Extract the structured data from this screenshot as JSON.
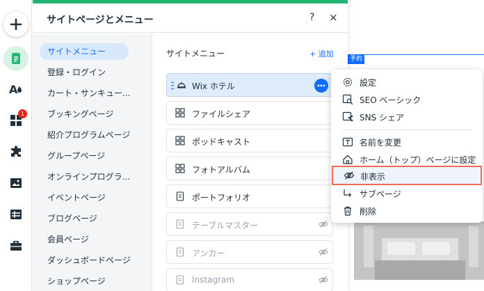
{
  "rail": {
    "items": [
      {
        "name": "add"
      },
      {
        "name": "pages"
      },
      {
        "name": "theme"
      },
      {
        "name": "apps",
        "badge": "1"
      },
      {
        "name": "plugins"
      },
      {
        "name": "media"
      },
      {
        "name": "table"
      },
      {
        "name": "business"
      }
    ]
  },
  "panel": {
    "title": "サイトページとメニュー",
    "help": "?",
    "close": "×",
    "categories": [
      "サイトメニュー",
      "登録・ログイン",
      "カート・サンキュー...",
      "ブッキングページ",
      "紹介プログラムページ",
      "グループページ",
      "オンラインプログラ...",
      "イベントページ",
      "ブログページ",
      "会員ページ",
      "ダッシュボードページ",
      "ショップページ"
    ],
    "active_category": "サイトメニュー",
    "menu_title": "サイトメニュー",
    "add_label": "+ 追加",
    "menu_items": [
      {
        "label": "Wix ホテル",
        "icon": "hotel-icon",
        "selected": true,
        "hidden": false
      },
      {
        "label": "ファイルシェア",
        "icon": "app-icon",
        "selected": false,
        "hidden": false
      },
      {
        "label": "ポッドキャスト",
        "icon": "app-icon",
        "selected": false,
        "hidden": false
      },
      {
        "label": "フォトアルバム",
        "icon": "app-icon",
        "selected": false,
        "hidden": false
      },
      {
        "label": "ポートフォリオ",
        "icon": "page-icon",
        "selected": false,
        "hidden": false
      },
      {
        "label": "テーブルマスター",
        "icon": "page-icon",
        "selected": false,
        "hidden": true
      },
      {
        "label": "アンカー",
        "icon": "page-icon",
        "selected": false,
        "hidden": true
      },
      {
        "label": "Instagram",
        "icon": "page-icon",
        "selected": false,
        "hidden": true
      }
    ]
  },
  "context_menu": {
    "items": [
      {
        "label": "設定",
        "icon": "gear-icon"
      },
      {
        "label": "SEO ベーシック",
        "icon": "seo-icon"
      },
      {
        "label": "SNS シェア",
        "icon": "share-icon"
      },
      {
        "label": "名前を変更",
        "icon": "rename-icon"
      },
      {
        "label": "ホーム（トップ）ページに設定",
        "icon": "home-icon"
      },
      {
        "label": "非表示",
        "icon": "eye-hidden-icon",
        "highlighted": true
      },
      {
        "label": "サブページ",
        "icon": "subpage-icon"
      },
      {
        "label": "削除",
        "icon": "trash-icon"
      }
    ]
  },
  "canvas": {
    "tag": "予約"
  },
  "colors": {
    "accent": "#116dff",
    "brand_green": "#22b573",
    "highlight_border": "#ef6c55",
    "badge_red": "#e62214"
  }
}
